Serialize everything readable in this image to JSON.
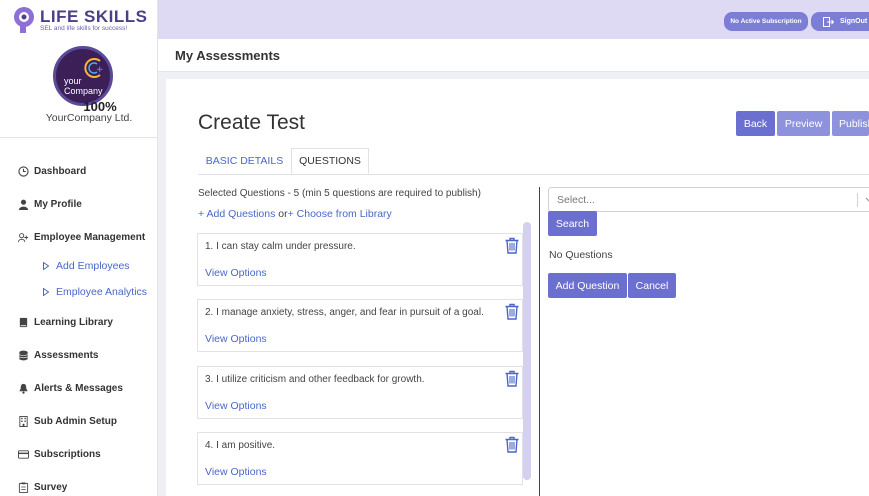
{
  "brand": {
    "name": "LIFE SKILLS",
    "tagline": "SEL and life skills for success!"
  },
  "company": {
    "logo_line1": "your",
    "logo_line2": "Company",
    "progress": "100%",
    "name": "YourCompany Ltd."
  },
  "sidebar": {
    "items": [
      {
        "label": "Dashboard",
        "icon": "clock-icon"
      },
      {
        "label": "My Profile",
        "icon": "user-icon"
      },
      {
        "label": "Employee Management",
        "icon": "users-icon"
      },
      {
        "label": "Learning Library",
        "icon": "book-icon"
      },
      {
        "label": "Assessments",
        "icon": "database-icon"
      },
      {
        "label": "Alerts & Messages",
        "icon": "bell-icon"
      },
      {
        "label": "Sub Admin Setup",
        "icon": "building-icon"
      },
      {
        "label": "Subscriptions",
        "icon": "card-icon"
      },
      {
        "label": "Survey",
        "icon": "clipboard-icon"
      }
    ],
    "sub_items": [
      {
        "label": "Add Employees"
      },
      {
        "label": "Employee Analytics"
      }
    ]
  },
  "topbar": {
    "subscription_label": "No Active Subscription",
    "signout_label": "SignOut"
  },
  "header": {
    "title": "My Assessments"
  },
  "page": {
    "title": "Create Test",
    "back_label": "Back",
    "preview_label": "Preview",
    "publish_label": "Publish",
    "tabs": [
      {
        "label": "BASIC DETAILS",
        "active": false
      },
      {
        "label": "QUESTIONS",
        "active": true
      }
    ],
    "selected_info": "Selected Questions - 5 (min 5 questions are required to publish)",
    "add_questions_link": "+ Add Questions",
    "or_text": "or",
    "library_link": "+ Choose from Library",
    "questions": [
      {
        "text": "1. I can stay calm under pressure.",
        "view": "View Options"
      },
      {
        "text": "2. I manage anxiety, stress, anger, and fear in pursuit of a goal.",
        "view": "View Options"
      },
      {
        "text": "3. I utilize criticism and other feedback for growth.",
        "view": "View Options"
      },
      {
        "text": "4. I am positive.",
        "view": "View Options"
      }
    ]
  },
  "search_panel": {
    "select_placeholder": "Select...",
    "search_label": "Search",
    "no_questions": "No Questions",
    "add_question_label": "Add Question",
    "cancel_label": "Cancel"
  },
  "colors": {
    "accent": "#6b6fd0",
    "link": "#4a67c8",
    "topbar": "#dfdaf3"
  }
}
